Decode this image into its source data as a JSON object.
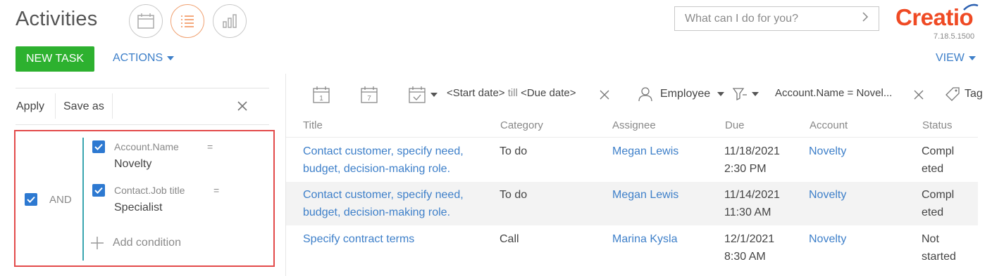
{
  "header": {
    "title": "Activities",
    "search_placeholder": "What can I do for you?",
    "logo": "Creatio",
    "version": "7.18.5.1500",
    "views": [
      "calendar-view-icon",
      "list-view-icon",
      "analytics-view-icon"
    ]
  },
  "toolbar": {
    "new_task": "NEW TASK",
    "actions": "ACTIONS",
    "view": "VIEW"
  },
  "filter_panel": {
    "apply": "Apply",
    "save_as": "Save as",
    "group_operator": "AND",
    "conditions": [
      {
        "field": "Account.Name",
        "operator": "=",
        "value": "Novelty",
        "checked": true
      },
      {
        "field": "Contact.Job title",
        "operator": "=",
        "value": "Specialist",
        "checked": true
      }
    ],
    "add_condition": "Add condition"
  },
  "quick_filters": {
    "date_from": "<Start date>",
    "date_till": "till",
    "date_to": "<Due date>",
    "employee": "Employee",
    "account_filter": "Account.Name = Novel...",
    "tag": "Tag",
    "calendar_day1": "1",
    "calendar_day7": "7"
  },
  "grid": {
    "columns": [
      "Title",
      "Category",
      "Assignee",
      "Due",
      "Account",
      "Status"
    ],
    "rows": [
      {
        "title_line1": "Contact customer, specify need,",
        "title_line2": "budget, decision-making role.",
        "category": "To do",
        "assignee": "Megan Lewis",
        "due_date": "11/18/2021",
        "due_time": "2:30 PM",
        "account": "Novelty",
        "status_line1": "Compl",
        "status_line2": "eted"
      },
      {
        "title_line1": "Contact customer, specify need,",
        "title_line2": "budget, decision-making role.",
        "category": "To do",
        "assignee": "Megan Lewis",
        "due_date": "11/14/2021",
        "due_time": "11:30 AM",
        "account": "Novelty",
        "status_line1": "Compl",
        "status_line2": "eted"
      },
      {
        "title_line1": "Specify contract terms",
        "title_line2": "",
        "category": "Call",
        "assignee": "Marina Kysla",
        "due_date": "12/1/2021",
        "due_time": "8:30 AM",
        "account": "Novelty",
        "status_line1": "Not",
        "status_line2": "started"
      }
    ]
  },
  "colors": {
    "accent_blue": "#3d7fc9",
    "new_task_green": "#2db12f",
    "brand_orange": "#ef4a24",
    "highlight_red": "#e34a4a",
    "group_teal": "#3aa6b0"
  }
}
